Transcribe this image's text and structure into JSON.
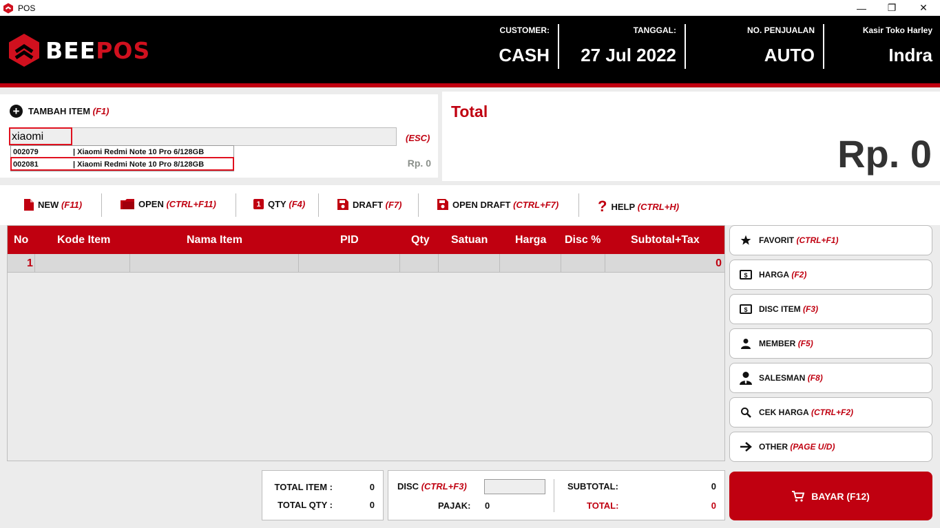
{
  "window": {
    "title": "POS",
    "minimize": "—",
    "maximize": "❐",
    "close": "✕"
  },
  "header": {
    "logo_part1": "BEE",
    "logo_part2": "POS",
    "customer_label": "CUSTOMER:",
    "customer_value": "CASH",
    "date_label": "TANGGAL:",
    "date_value": "27 Jul 2022",
    "sales_no_label": "NO. PENJUALAN",
    "sales_no_value": "AUTO",
    "cashier_label": "Kasir Toko Harley",
    "cashier_value": "Indra"
  },
  "add_item": {
    "title": "TAMBAH ITEM",
    "shortcut": "(F1)",
    "search_value": "xiaomi",
    "esc_label": "(ESC)",
    "price_placeholder": "Rp. 0",
    "suggestions": [
      {
        "code": "002079",
        "name": "| Xiaomi Redmi Note 10 Pro 6/128GB"
      },
      {
        "code": "002081",
        "name": "| Xiaomi Redmi Note 10 Pro 8/128GB"
      }
    ]
  },
  "total_panel": {
    "title": "Total",
    "value": "Rp. 0"
  },
  "toolbar": {
    "items": [
      {
        "label": "NEW",
        "shortcut": "(F11)",
        "icon": "file-icon"
      },
      {
        "label": "OPEN",
        "shortcut": "(CTRL+F11)",
        "icon": "folder-icon"
      },
      {
        "label": "QTY",
        "shortcut": "(F4)",
        "icon": "qty-icon",
        "badge": "1"
      },
      {
        "label": "DRAFT",
        "shortcut": "(F7)",
        "icon": "save-icon"
      },
      {
        "label": "OPEN DRAFT",
        "shortcut": "(CTRL+F7)",
        "icon": "save-icon"
      },
      {
        "label": "HELP",
        "shortcut": "(CTRL+H)",
        "icon": "help-icon",
        "glyph": "?"
      }
    ]
  },
  "table": {
    "columns": [
      "No",
      "Kode Item",
      "Nama Item",
      "PID",
      "Qty",
      "Satuan",
      "Harga",
      "Disc %",
      "Subtotal+Tax"
    ],
    "rows": [
      {
        "no": "1",
        "kode": "",
        "nama": "",
        "pid": "",
        "qty": "",
        "satuan": "",
        "harga": "",
        "disc": "",
        "subtotal": "0"
      }
    ]
  },
  "side_buttons": [
    {
      "label": "FAVORIT",
      "shortcut": "(CTRL+F1)",
      "icon": "star-icon"
    },
    {
      "label": "HARGA",
      "shortcut": "(F2)",
      "icon": "money-icon"
    },
    {
      "label": "DISC ITEM",
      "shortcut": "(F3)",
      "icon": "money-icon"
    },
    {
      "label": "MEMBER",
      "shortcut": "(F5)",
      "icon": "person-icon"
    },
    {
      "label": "SALESMAN",
      "shortcut": "(F8)",
      "icon": "salesman-icon"
    },
    {
      "label": "CEK HARGA",
      "shortcut": "(CTRL+F2)",
      "icon": "search-icon"
    },
    {
      "label": "OTHER",
      "shortcut": "(PAGE U/D)",
      "icon": "arrow-right-icon"
    }
  ],
  "summary": {
    "total_item_label": "TOTAL ITEM :",
    "total_item_value": "0",
    "total_qty_label": "TOTAL QTY :",
    "total_qty_value": "0",
    "disc_label": "DISC",
    "disc_shortcut": "(CTRL+F3)",
    "disc_value": "",
    "pajak_label": "PAJAK:",
    "pajak_value": "0",
    "subtotal_label": "SUBTOTAL:",
    "subtotal_value": "0",
    "total_label": "TOTAL:",
    "total_value": "0"
  },
  "pay_button": {
    "label": "BAYAR (F12)"
  },
  "colors": {
    "brand_red": "#c00010",
    "header_bg": "#000000"
  }
}
